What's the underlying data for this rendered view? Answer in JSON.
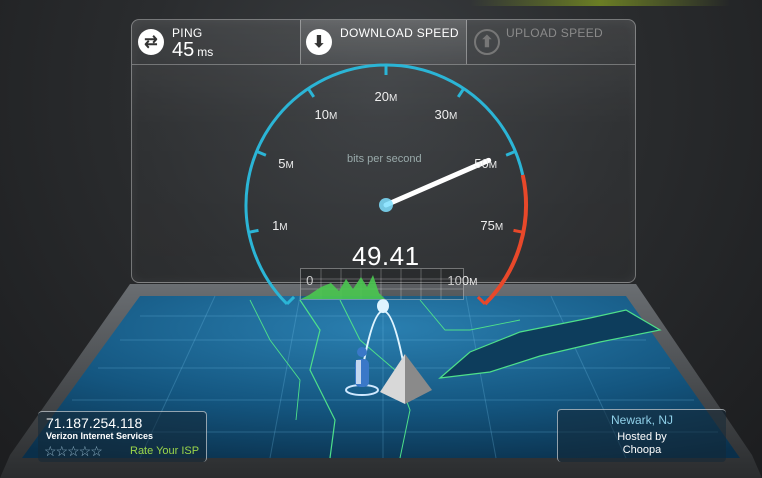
{
  "stats": {
    "ping_label": "PING",
    "ping_value": "45",
    "ping_unit": "ms",
    "download_label": "DOWNLOAD SPEED",
    "upload_label": "UPLOAD SPEED"
  },
  "gauge": {
    "ticks": [
      {
        "num": "0",
        "unit": ""
      },
      {
        "num": "1",
        "unit": "M"
      },
      {
        "num": "5",
        "unit": "M"
      },
      {
        "num": "10",
        "unit": "M"
      },
      {
        "num": "20",
        "unit": "M"
      },
      {
        "num": "30",
        "unit": "M"
      },
      {
        "num": "50",
        "unit": "M"
      },
      {
        "num": "75",
        "unit": "M"
      },
      {
        "num": "100",
        "unit": "M"
      }
    ],
    "units_label": "bits per second",
    "speed_value": "49.41",
    "needle_speed_mbps": 49.41,
    "colors": {
      "arc": "#2bb5d6",
      "danger": "#e8482a",
      "needle": "#ffffff",
      "graph": "#4ac850"
    }
  },
  "isp": {
    "ip": "71.187.254.118",
    "name": "Verizon Internet Services",
    "stars": "☆☆☆☆☆",
    "rate_label": "Rate Your ISP"
  },
  "server": {
    "location": "Newark, NJ",
    "hosted_label": "Hosted by",
    "host": "Choopa"
  },
  "icons": {
    "ping": "swap-arrows-icon",
    "download": "download-arrow-icon",
    "upload": "upload-arrow-icon"
  }
}
